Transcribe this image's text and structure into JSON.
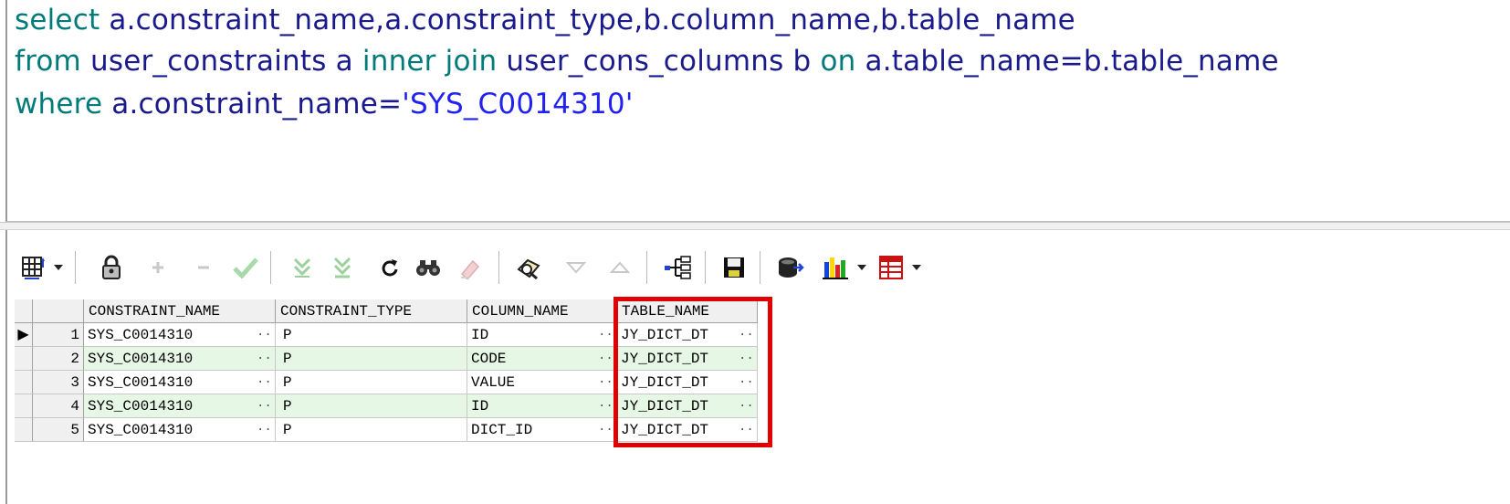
{
  "sql_editor": {
    "lines": [
      [
        {
          "t": "select",
          "c": "kw"
        },
        {
          "t": " a.constraint_name,a.constraint_type,b.column_name,b.table_name",
          "c": "id"
        }
      ],
      [
        {
          "t": "from",
          "c": "kw"
        },
        {
          "t": " user_constraints a ",
          "c": "id"
        },
        {
          "t": "inner join",
          "c": "kw"
        },
        {
          "t": " user_cons_columns b ",
          "c": "id"
        },
        {
          "t": "on",
          "c": "kw"
        },
        {
          "t": " a.table_name=b.table_name",
          "c": "id"
        }
      ],
      [
        {
          "t": "where",
          "c": "kw"
        },
        {
          "t": " a.constraint_name=",
          "c": "id"
        },
        {
          "t": "'SYS_C0014310'",
          "c": "str"
        }
      ]
    ]
  },
  "toolbar": {
    "items": [
      "grid-options-icon",
      "dropdown-arrow-icon",
      "lock-icon",
      "add-record-icon",
      "delete-record-icon",
      "post-changes-icon",
      "fetch-next-icon",
      "fetch-last-icon",
      "refresh-icon",
      "find-icon",
      "clear-icon",
      "query-by-example-icon",
      "previous-icon",
      "next-icon",
      "tree-view-icon",
      "save-icon",
      "export-icon",
      "chart-icon",
      "dropdown-arrow-icon",
      "table-view-icon",
      "dropdown-arrow-icon"
    ]
  },
  "grid": {
    "columns": [
      "CONSTRAINT_NAME",
      "CONSTRAINT_TYPE",
      "COLUMN_NAME",
      "TABLE_NAME"
    ],
    "rows": [
      {
        "n": "1",
        "constraint_name": "SYS_C0014310",
        "constraint_type": "P",
        "column_name": "ID",
        "table_name": "JY_DICT_DT"
      },
      {
        "n": "2",
        "constraint_name": "SYS_C0014310",
        "constraint_type": "P",
        "column_name": "CODE",
        "table_name": "JY_DICT_DT"
      },
      {
        "n": "3",
        "constraint_name": "SYS_C0014310",
        "constraint_type": "P",
        "column_name": "VALUE",
        "table_name": "JY_DICT_DT"
      },
      {
        "n": "4",
        "constraint_name": "SYS_C0014310",
        "constraint_type": "P",
        "column_name": "ID",
        "table_name": "JY_DICT_DT"
      },
      {
        "n": "5",
        "constraint_name": "SYS_C0014310",
        "constraint_type": "P",
        "column_name": "DICT_ID",
        "table_name": "JY_DICT_DT"
      }
    ],
    "current_row_indicator": "▶",
    "ellipsis": "···"
  },
  "colors": {
    "keyword": "#007a7a",
    "identifier": "#1a1a8c",
    "string": "#2222ee",
    "alt_row": "#e6f7e6",
    "highlight_box": "#e00000"
  }
}
